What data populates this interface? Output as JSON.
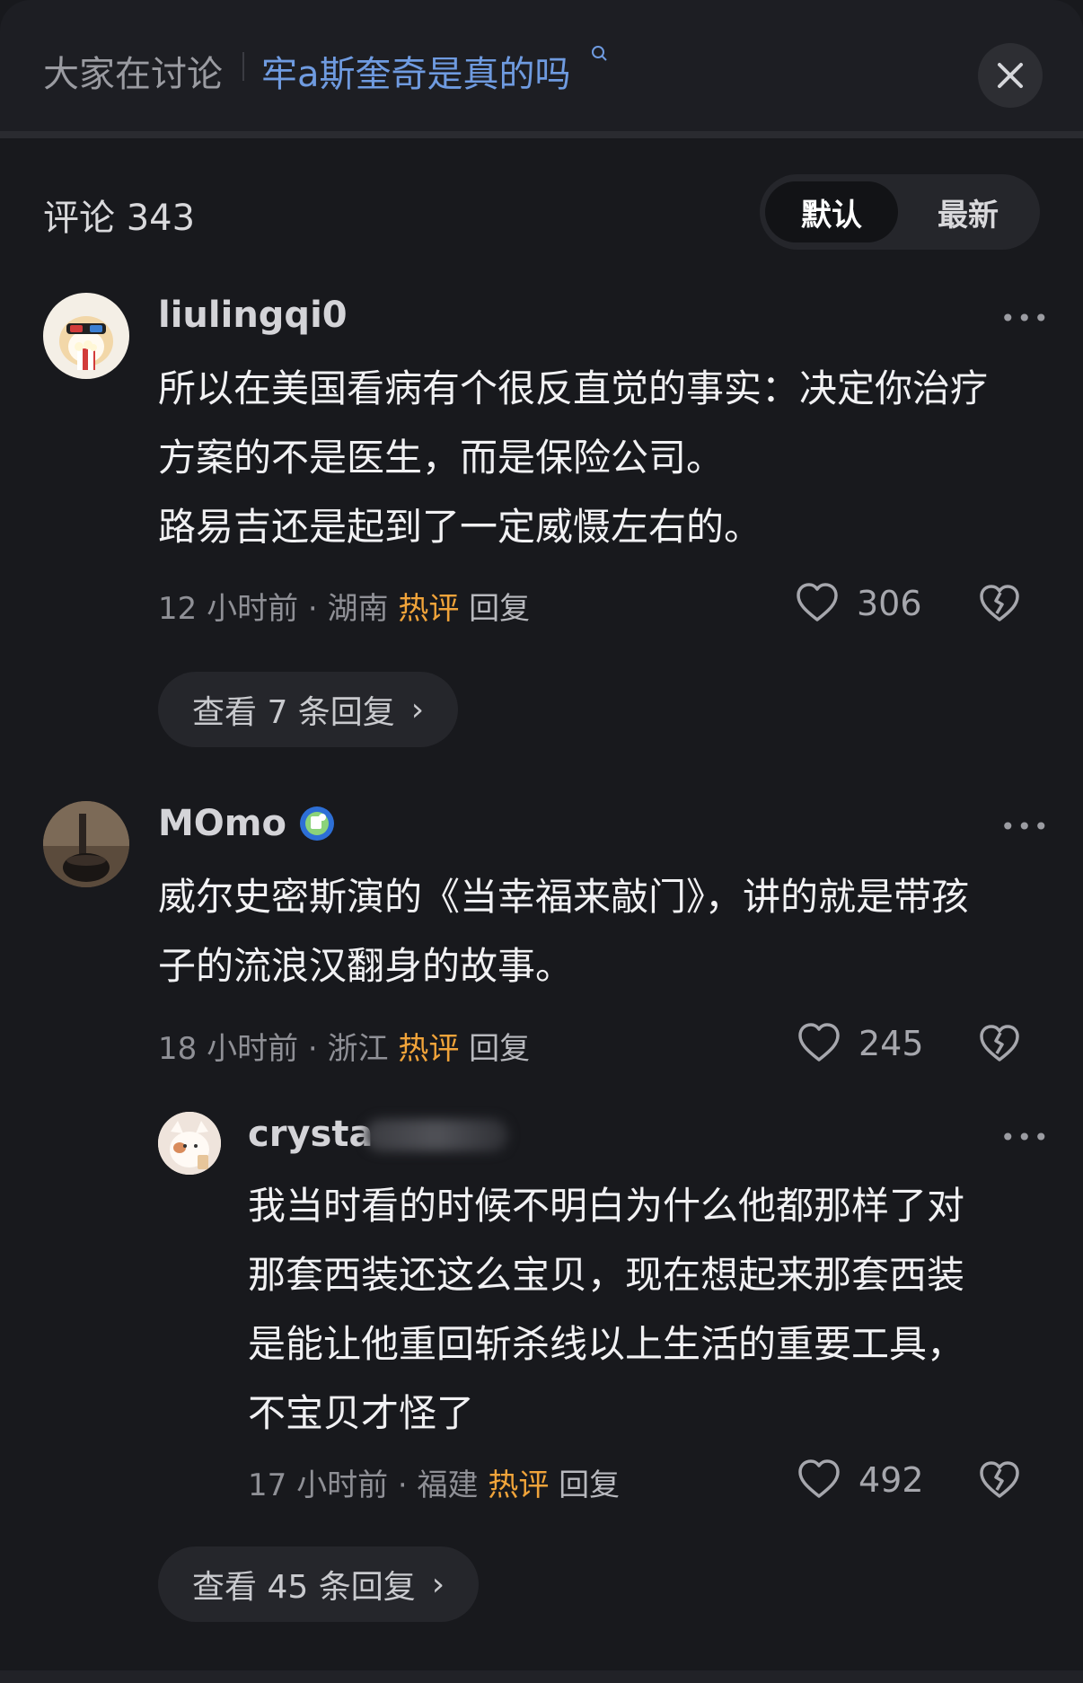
{
  "header": {
    "discuss_label": "大家在讨论",
    "topic": "牢a斯奎奇是真的吗",
    "close_icon": "close-icon"
  },
  "comments_header": {
    "count_label": "评论 343",
    "sort_default": "默认",
    "sort_latest": "最新"
  },
  "comments": [
    {
      "username": "liulingqi0",
      "lines": [
        "所以在美国看病有个很反直觉的事实：决定你治疗",
        "方案的不是医生，而是保险公司。",
        "路易吉还是起到了一定威慑左右的。"
      ],
      "time": "12 小时前",
      "location": "湖南",
      "hot": "热评",
      "reply": "回复",
      "likes": "306",
      "view_replies": "查看 7 条回复"
    },
    {
      "username": "MOmo",
      "lines": [
        "威尔史密斯演的《当幸福来敲门》，讲的就是带孩",
        "子的流浪汉翻身的故事。"
      ],
      "time": "18 小时前",
      "location": "浙江",
      "hot": "热评",
      "reply": "回复",
      "likes": "245",
      "view_replies": "查看 45 条回复"
    }
  ],
  "reply": {
    "username": "crysta",
    "lines": [
      "我当时看的时候不明白为什么他都那样了对",
      "那套西装还这么宝贝，现在想起来那套西装",
      "是能让他重回斩杀线以上生活的重要工具，",
      "不宝贝才怪了"
    ],
    "time": "17 小时前",
    "location": "福建",
    "hot": "热评",
    "reply": "回复",
    "likes": "492"
  },
  "separator": "·",
  "more_label": "•••",
  "chevron": "›",
  "colors": {
    "background": "#18191d",
    "topic": "#6f9be0",
    "hot": "#f1a43a"
  }
}
